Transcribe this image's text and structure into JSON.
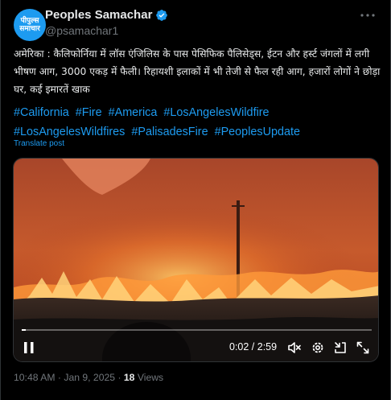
{
  "author": {
    "display_name": "Peoples Samachar",
    "handle": "@psamachar1",
    "avatar_logo_lines": [
      "पीपुल्स",
      "समाचार"
    ],
    "verified_color": "#1d9bf0"
  },
  "post": {
    "text": "अमेरिका : कैलिफोर्निया में लॉस एंजिलिस के पास पेसिफिक पैलिसेड्स, ईटन और हर्स्ट जंगलों में लगी भीषण आग, 3000 एकड़ में फैली। रिहायशी इलाकों में भी तेजी से फैल रही आग, हजारों लोगों ने छोड़ा घर, कई इमारतें खाक",
    "hashtags": [
      "#California",
      "#Fire",
      "#America",
      "#LosAngelesWildfire",
      "#LosAngelesWildfires",
      "#PalisadesFire",
      "#PeoplesUpdate"
    ],
    "translate_label": "Translate post"
  },
  "video": {
    "current_time": "0:02",
    "duration": "2:59",
    "time_display": "0:02 / 2:59",
    "progress_fraction": 0.011
  },
  "meta": {
    "time": "10:48 AM",
    "date": "Jan 9, 2025",
    "views_count": "18",
    "views_label": "Views"
  },
  "colors": {
    "accent": "#1d9bf0",
    "muted": "#71767b",
    "text": "#e7e9ea",
    "background": "#000000"
  },
  "icons": {
    "more": "more-horizontal-icon",
    "verified": "verified-badge-icon",
    "pause": "pause-icon",
    "mute": "volume-muted-icon",
    "settings": "gear-icon",
    "minimize": "minimize-player-icon",
    "fullscreen": "fullscreen-icon"
  }
}
